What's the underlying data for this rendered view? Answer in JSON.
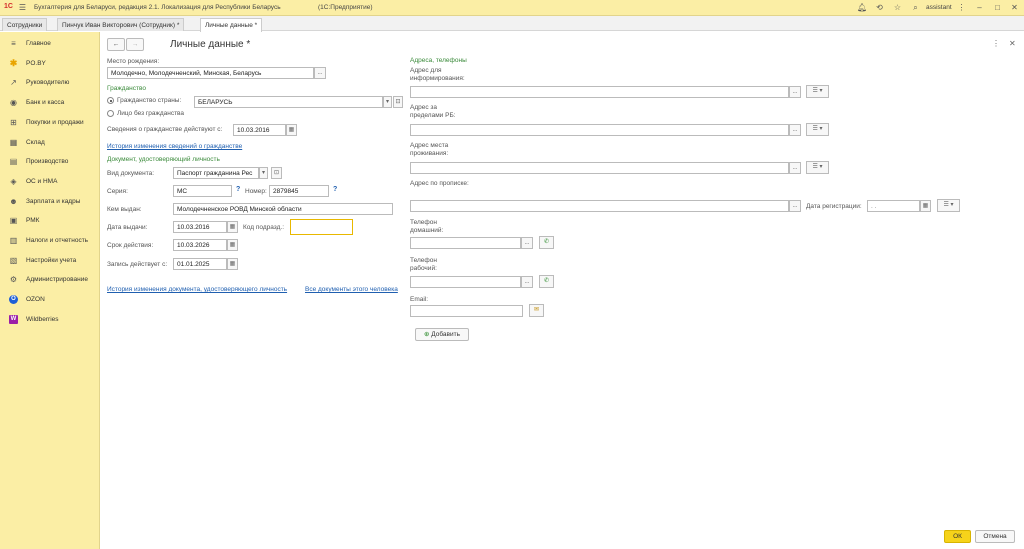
{
  "app": {
    "logo": "1С",
    "title": "Бухгалтерия для Беларуси, редакция 2.1. Локализация для Республики Беларусь",
    "platform": "(1С:Предприятие)",
    "user": "assistant"
  },
  "tabs": [
    "Сотрудники",
    "Пинчук Иван Викторович (Сотрудник) *",
    "Личные данные *"
  ],
  "sidebar": {
    "items": [
      {
        "label": "Главное",
        "icon": "≡"
      },
      {
        "label": "PO.BY",
        "icon": "✱"
      },
      {
        "label": "Руководителю",
        "icon": "↗"
      },
      {
        "label": "Банк и касса",
        "icon": "◉"
      },
      {
        "label": "Покупки и продажи",
        "icon": "⊞"
      },
      {
        "label": "Склад",
        "icon": "▦"
      },
      {
        "label": "Производство",
        "icon": "▤"
      },
      {
        "label": "ОС и НМА",
        "icon": "◈"
      },
      {
        "label": "Зарплата и кадры",
        "icon": "☻"
      },
      {
        "label": "РМК",
        "icon": "▣"
      },
      {
        "label": "Налоги и отчетность",
        "icon": "▥"
      },
      {
        "label": "Настройки учета",
        "icon": "▧"
      },
      {
        "label": "Администрирование",
        "icon": "⚙"
      },
      {
        "label": "OZON",
        "icon": "O"
      },
      {
        "label": "Wildberries",
        "icon": "W"
      }
    ]
  },
  "form": {
    "title": "Личные данные *",
    "birthplace_label": "Место рождения:",
    "birthplace_value": "Молодечно, Молодечненский, Минская, Беларусь",
    "citizenship_header": "Гражданство",
    "citizenship_country_label": "Гражданство страны:",
    "citizenship_country_value": "БЕЛАРУСЬ",
    "stateless_label": "Лицо без гражданства",
    "citizenship_since_label": "Сведения о гражданстве действуют с:",
    "citizenship_since_value": "10.03.2016",
    "citizenship_history_link": "История изменения сведений о гражданстве",
    "document_header": "Документ, удостоверяющий личность",
    "doc_type_label": "Вид документа:",
    "doc_type_value": "Паспорт гражданина Рес",
    "series_label": "Серия:",
    "series_value": "MC",
    "number_label": "Номер:",
    "number_value": "2879845",
    "issued_by_label": "Кем выдан:",
    "issued_by_value": "Молодечненское РОВД Минской области",
    "issue_date_label": "Дата выдачи:",
    "issue_date_value": "10.03.2016",
    "dept_code_label": "Код подразд.:",
    "dept_code_value": "",
    "validity_label": "Срок действия:",
    "validity_value": "10.03.2026",
    "record_since_label": "Запись действует с:",
    "record_since_value": "01.01.2025",
    "doc_history_link": "История изменения документа, удостоверяющего личность",
    "all_docs_link": "Все документы этого человека",
    "question_mark": "?",
    "ellipsis": "...",
    "addresses_header": "Адреса, телефоны",
    "addr_info_label": "Адрес для информирования:",
    "addr_abroad_label": "Адрес за пределами РБ:",
    "addr_residence_label": "Адрес места проживания:",
    "addr_registration_label": "Адрес по прописке:",
    "registration_date_label": "Дата регистрации:",
    "registration_date_value": " .  .",
    "phone_home_label": "Телефон домашний:",
    "phone_work_label": "Телефон рабочий:",
    "email_label": "Email:",
    "add_button": "Добавить"
  },
  "footer": {
    "ok": "ОК",
    "cancel": "Отмена"
  }
}
